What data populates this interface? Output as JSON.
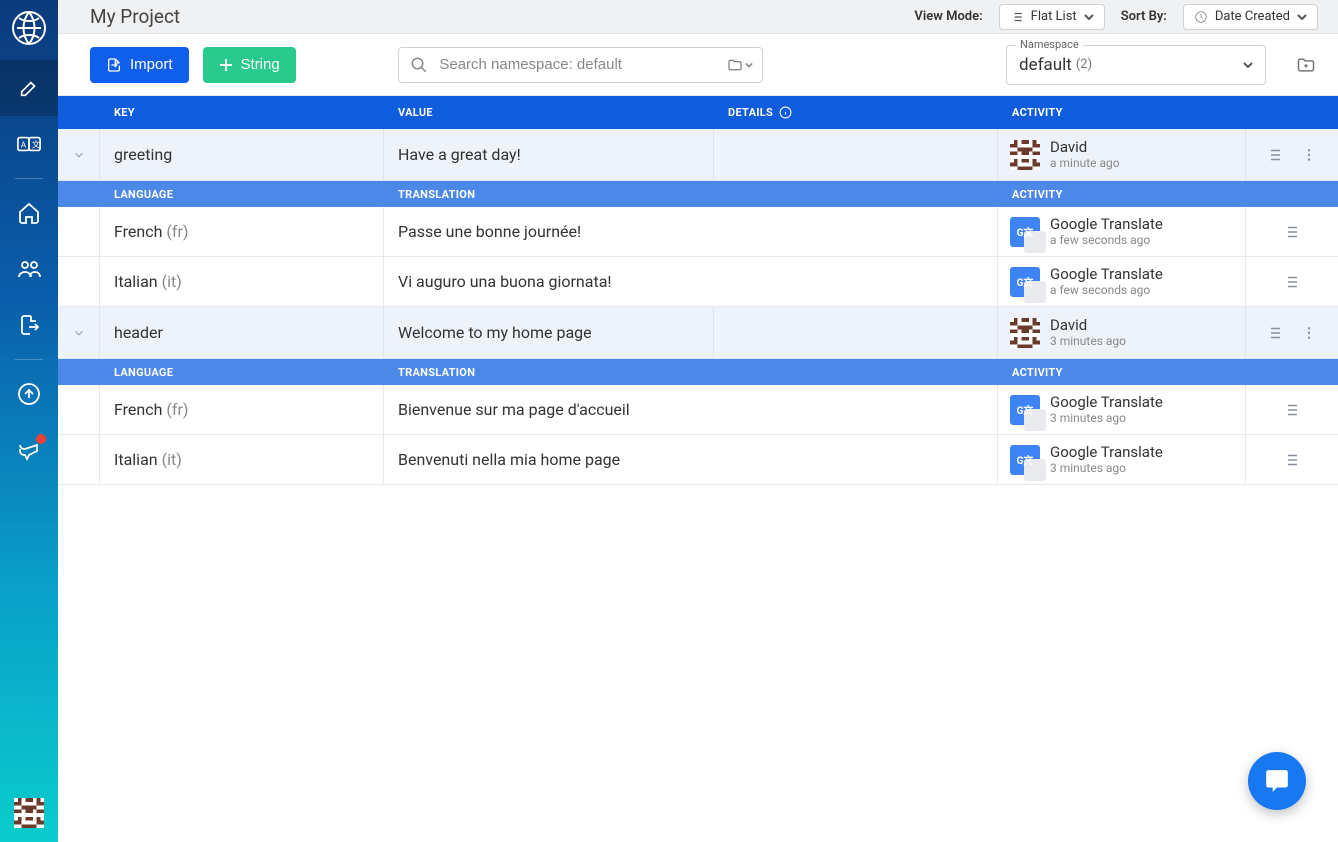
{
  "sidebar": {
    "items": [
      {
        "name": "edit",
        "label": ""
      },
      {
        "name": "translations",
        "label": ""
      },
      {
        "name": "home",
        "label": ""
      },
      {
        "name": "team",
        "label": ""
      },
      {
        "name": "export",
        "label": ""
      },
      {
        "name": "upload",
        "label": ""
      },
      {
        "name": "announcements",
        "label": ""
      }
    ]
  },
  "topbar": {
    "view_mode_label": "View Mode:",
    "view_mode_value": "Flat List",
    "sort_by_label": "Sort By:",
    "sort_by_value": "Date Created"
  },
  "title": "My Project",
  "toolbar": {
    "import_label": "Import",
    "string_label": "String",
    "search_placeholder": "Search namespace: default",
    "namespace_label": "Namespace",
    "namespace_value": "default",
    "namespace_count": "(2)"
  },
  "columns": {
    "key": "KEY",
    "value": "VALUE",
    "details": "DETAILS",
    "activity": "ACTIVITY",
    "language": "LANGUAGE",
    "translation": "TRANSLATION"
  },
  "rows": [
    {
      "key": "greeting",
      "value": "Have a great day!",
      "actor": "David",
      "when": "a minute ago",
      "actor_type": "user",
      "translations": [
        {
          "lang": "French",
          "code": "(fr)",
          "text": "Passe une bonne journée!",
          "actor": "Google Translate",
          "when": "a few seconds ago"
        },
        {
          "lang": "Italian",
          "code": "(it)",
          "text": "Vi auguro una buona giornata!",
          "actor": "Google Translate",
          "when": "a few seconds ago"
        }
      ]
    },
    {
      "key": "header",
      "value": "Welcome to my home page",
      "actor": "David",
      "when": "3 minutes ago",
      "actor_type": "user",
      "translations": [
        {
          "lang": "French",
          "code": "(fr)",
          "text": "Bienvenue sur ma page d'accueil",
          "actor": "Google Translate",
          "when": "3 minutes ago"
        },
        {
          "lang": "Italian",
          "code": "(it)",
          "text": "Benvenuti nella mia home page",
          "actor": "Google Translate",
          "when": "3 minutes ago"
        }
      ]
    }
  ]
}
